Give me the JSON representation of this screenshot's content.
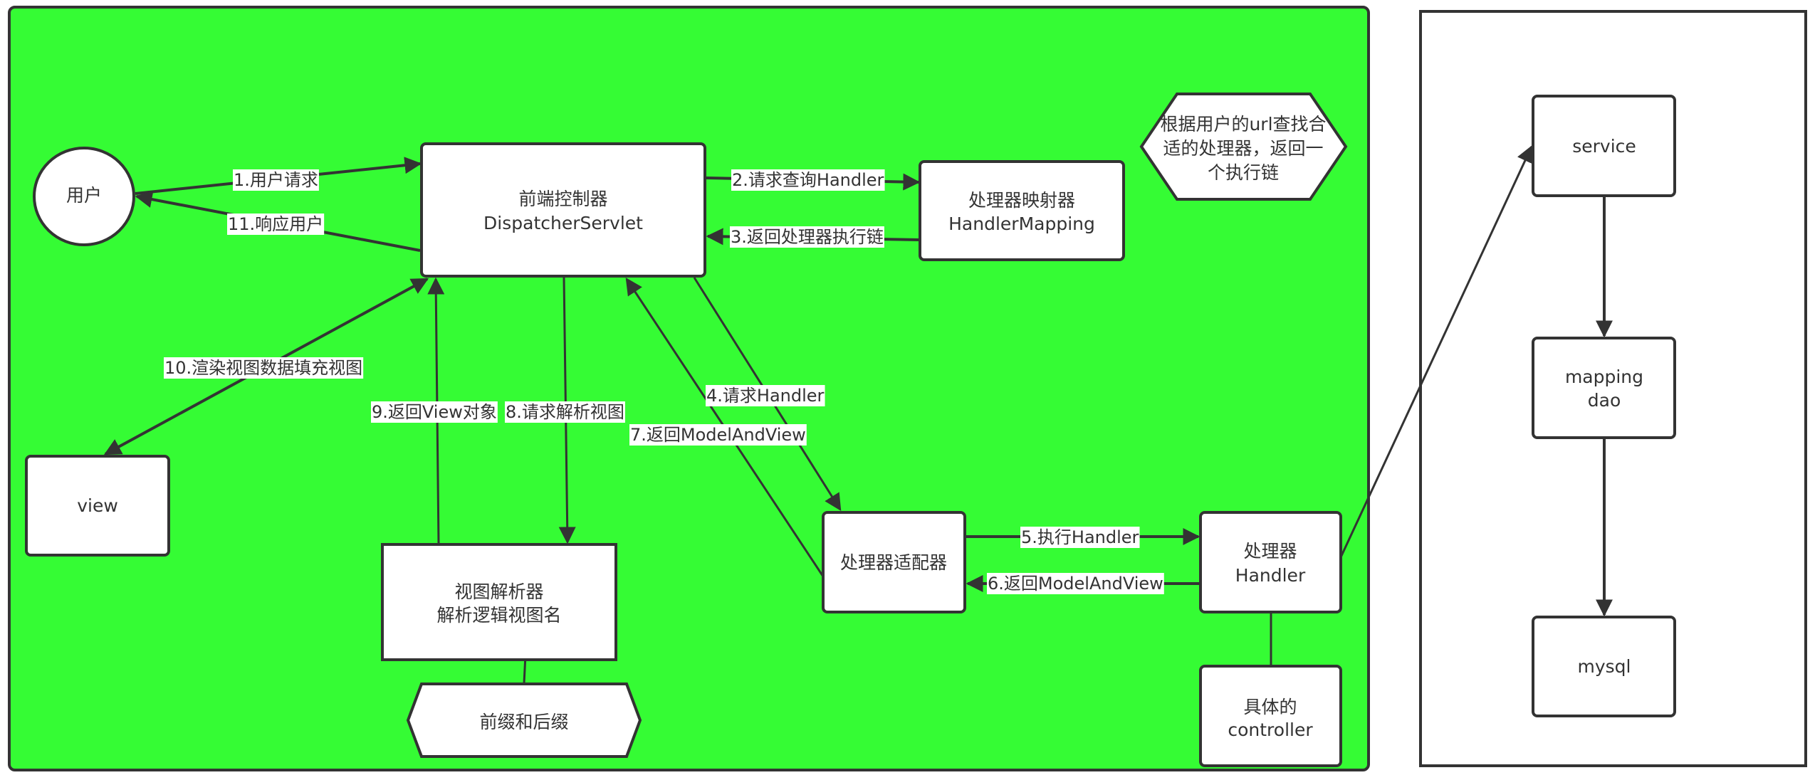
{
  "colors": {
    "container_fill": "#35fc34",
    "stroke": "#333333",
    "node_fill": "#ffffff",
    "text": "#333333"
  },
  "nodes": {
    "user": {
      "label": [
        "用户"
      ]
    },
    "dispatcher": {
      "label": [
        "前端控制器",
        "DispatcherServlet"
      ]
    },
    "handler_mapping": {
      "label": [
        "处理器映射器",
        "HandlerMapping"
      ]
    },
    "mapping_note": {
      "label": [
        "根据用户的url查找合",
        "适的处理器，返回一",
        "个执行链"
      ]
    },
    "view": {
      "label": [
        "view"
      ]
    },
    "view_resolver": {
      "label": [
        "视图解析器",
        "解析逻辑视图名"
      ]
    },
    "prefix_suffix": {
      "label": [
        "前缀和后缀"
      ]
    },
    "handler_adapter": {
      "label": [
        "处理器适配器"
      ]
    },
    "handler": {
      "label": [
        "处理器",
        "Handler"
      ]
    },
    "controller": {
      "label": [
        "具体的",
        "controller"
      ]
    },
    "service": {
      "label": [
        "service"
      ]
    },
    "mapping_dao": {
      "label": [
        "mapping",
        "dao"
      ]
    },
    "mysql": {
      "label": [
        "mysql"
      ]
    }
  },
  "edges": [
    {
      "id": "e1",
      "label": "1.用户请求",
      "from": "user",
      "to": "dispatcher"
    },
    {
      "id": "e11",
      "label": "11.响应用户",
      "from": "dispatcher",
      "to": "user"
    },
    {
      "id": "e2",
      "label": "2.请求查询Handler",
      "from": "dispatcher",
      "to": "handler_mapping"
    },
    {
      "id": "e3",
      "label": "3.返回处理器执行链",
      "from": "handler_mapping",
      "to": "dispatcher"
    },
    {
      "id": "e4",
      "label": "4.请求Handler",
      "from": "dispatcher",
      "to": "handler_adapter"
    },
    {
      "id": "e5",
      "label": "5.执行Handler",
      "from": "handler_adapter",
      "to": "handler"
    },
    {
      "id": "e6",
      "label": "6.返回ModelAndView",
      "from": "handler",
      "to": "handler_adapter"
    },
    {
      "id": "e7",
      "label": "7.返回ModelAndView",
      "from": "handler_adapter",
      "to": "dispatcher"
    },
    {
      "id": "e8",
      "label": "8.请求解析视图",
      "from": "dispatcher",
      "to": "view_resolver"
    },
    {
      "id": "e9",
      "label": "9.返回View对象",
      "from": "view_resolver",
      "to": "dispatcher"
    },
    {
      "id": "e10",
      "label": "10.渲染视图数据填充视图",
      "from": "dispatcher",
      "to": "view"
    },
    {
      "id": "e_handler_service",
      "label": "",
      "from": "handler",
      "to": "service"
    },
    {
      "id": "e_service_dao",
      "label": "",
      "from": "service",
      "to": "mapping_dao"
    },
    {
      "id": "e_dao_mysql",
      "label": "",
      "from": "mapping_dao",
      "to": "mysql"
    },
    {
      "id": "e_handler_controller",
      "label": "",
      "from": "handler",
      "to": "controller"
    },
    {
      "id": "e_resolver_prefix",
      "label": "",
      "from": "view_resolver",
      "to": "prefix_suffix"
    }
  ]
}
